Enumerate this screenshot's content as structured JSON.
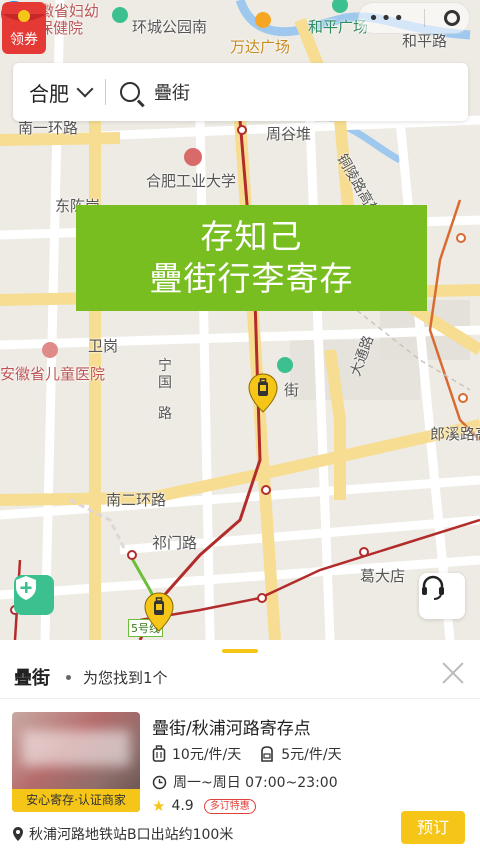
{
  "map": {
    "labels": {
      "maternal_hospital_1": "安徽省妇幼",
      "maternal_hospital_2": "保健院",
      "wanda_park": "环城公园南",
      "wanda_plaza": "万达广场",
      "heping_square": "和平广场",
      "heping_road": "和平路",
      "ring1": "南一环路",
      "zhougudui": "周谷堆",
      "tongling_road": "铜陵路高架",
      "hfut": "合肥工业大学",
      "dongchen": "东陈岗",
      "weigang": "卫岗",
      "children_hospital": "安徽省儿童医院",
      "ningguo_1": "宁",
      "ningguo_2": "国",
      "ningguo_3": "路",
      "leijie_map": "街",
      "dazhong_road": "大通路",
      "langxi_road": "郎溪路高",
      "ring2": "南二环路",
      "qimen_road": "祁门路",
      "gedadian": "葛大店",
      "metro_line5": "5号线"
    }
  },
  "search": {
    "city": "合肥",
    "query": "疊街"
  },
  "banner": {
    "line1": "存知己",
    "line2": "疊街行李寄存"
  },
  "redpacket": {
    "label": "领券"
  },
  "panel": {
    "title": "疊街",
    "subtitle": "为您找到1个"
  },
  "store": {
    "name": "疊街/秋浦河路寄存点",
    "thumb_tag": "安心寄存·认证商家",
    "price_large": "10元/件/天",
    "price_small": "5元/件/天",
    "hours": "周一~周日 07:00~23:00",
    "rating": "4.9",
    "discount_badge": "多订特惠",
    "address": "秋浦河路地铁站B口出站约100米",
    "book_label": "预订"
  },
  "colors": {
    "accent_yellow": "#f5c518",
    "banner_green": "#79be20",
    "metro_red": "#b32c2c",
    "pin_blue": "#1e88e5"
  }
}
